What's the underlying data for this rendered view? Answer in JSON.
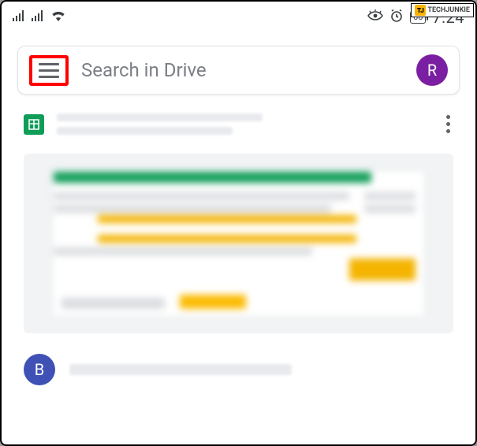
{
  "watermark": {
    "brand": "TECHJUNKIE",
    "tag": "TJ"
  },
  "statusbar": {
    "battery_pct": "60",
    "clock": "7:24"
  },
  "search": {
    "placeholder": "Search in Drive",
    "avatar_initial": "R"
  },
  "files": [
    {
      "type": "sheets",
      "title_redacted": true
    },
    {
      "type": "generic",
      "bubble": "B",
      "title_redacted": true
    }
  ]
}
